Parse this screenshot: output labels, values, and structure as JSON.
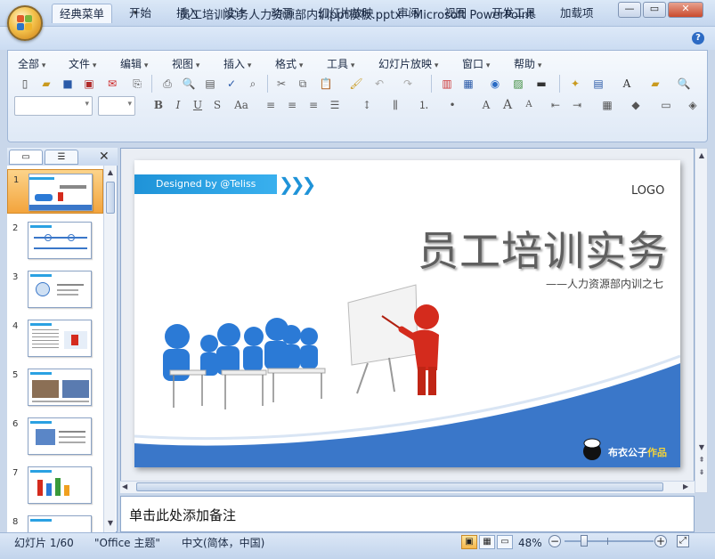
{
  "window": {
    "title": "员工培训实务人力资源部内训ppt模板.pptx - Microsoft PowerPoint"
  },
  "ribbon_tabs": [
    "经典菜单",
    "开始",
    "插入",
    "设计",
    "动画",
    "幻灯片放映",
    "审阅",
    "视图",
    "开发工具",
    "加载项"
  ],
  "menus": [
    "全部",
    "文件",
    "编辑",
    "视图",
    "插入",
    "格式",
    "工具",
    "幻灯片放映",
    "窗口",
    "帮助"
  ],
  "slide_numbers": [
    "1",
    "2",
    "3",
    "4",
    "5",
    "6",
    "7",
    "8"
  ],
  "slide": {
    "designed_by": "Designed by @Teliss",
    "logo": "LOGO",
    "title": "员工培训实务",
    "subtitle": "——人力资源部内训之七",
    "credit_name": "布衣公子",
    "credit_suffix": "作品"
  },
  "notes": {
    "placeholder": "单击此处添加备注"
  },
  "status": {
    "slide_count": "幻灯片 1/60",
    "theme": "\"Office 主题\"",
    "language": "中文(简体，中国)",
    "zoom": "48%"
  },
  "colors": {
    "accent_blue": "#3a77c9",
    "title_gray": "#5f5f5f",
    "figure_red": "#d42b1d",
    "figure_blue": "#2b7ad6"
  }
}
